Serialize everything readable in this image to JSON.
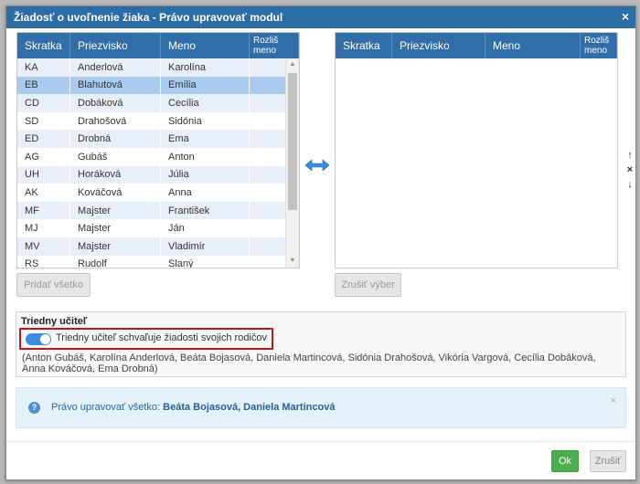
{
  "dialog": {
    "title": "Žiadosť o uvoľnenie žiaka - Právo upravovať modul",
    "close_glyph": "×"
  },
  "left_grid": {
    "columns": [
      "Skratka",
      "Priezvisko",
      "Meno",
      "Rozliš meno"
    ],
    "rows": [
      {
        "skratka": "KA",
        "priezvisko": "Anderlová",
        "meno": "Karolína"
      },
      {
        "skratka": "EB",
        "priezvisko": "Blahutová",
        "meno": "Emília"
      },
      {
        "skratka": "CD",
        "priezvisko": "Dobáková",
        "meno": "Cecília"
      },
      {
        "skratka": "SD",
        "priezvisko": "Drahošová",
        "meno": "Sidónia"
      },
      {
        "skratka": "ED",
        "priezvisko": "Drobná",
        "meno": "Ema"
      },
      {
        "skratka": "AG",
        "priezvisko": "Gubáš",
        "meno": "Anton"
      },
      {
        "skratka": "UH",
        "priezvisko": "Horáková",
        "meno": "Júlia"
      },
      {
        "skratka": "AK",
        "priezvisko": "Kováčová",
        "meno": "Anna"
      },
      {
        "skratka": "MF",
        "priezvisko": "Majster",
        "meno": "František"
      },
      {
        "skratka": "MJ",
        "priezvisko": "Majster",
        "meno": "Ján"
      },
      {
        "skratka": "MV",
        "priezvisko": "Majster",
        "meno": "Vladimír"
      },
      {
        "skratka": "RS",
        "priezvisko": "Rudolf",
        "meno": "Slaný"
      }
    ],
    "selected_index": 1
  },
  "right_grid": {
    "columns": [
      "Skratka",
      "Priezvisko",
      "Meno",
      "Rozliš meno"
    ]
  },
  "buttons": {
    "add_all": "Pridať všetko",
    "clear_selection": "Zrušiť výber",
    "ok": "Ok",
    "cancel": "Zrušiť"
  },
  "class_teacher": {
    "legend": "Triedny učiteľ",
    "toggle_label": "Triedny učiteľ schvaľuje žiadosti svojich rodičov",
    "toggle_on": true,
    "names_text": "(Anton Gubáš, Karolína Anderlová, Beáta Bojasová, Daniela Martincová, Sidónia Drahošová, Vikória Vargová, Cecília Dobáková, Anna Kováčová, Ema Drobná)"
  },
  "info": {
    "prefix": "Právo upravovať všetko:",
    "names": "Beáta Bojasová, Daniela Martincová",
    "close_glyph": "×"
  },
  "side_icons": [
    "↑",
    "×",
    "↓"
  ],
  "colors": {
    "header_blue": "#2d6da5",
    "selected_row": "#aacbf0",
    "ok_green": "#4cae4c",
    "highlight_red": "#c0161b"
  }
}
